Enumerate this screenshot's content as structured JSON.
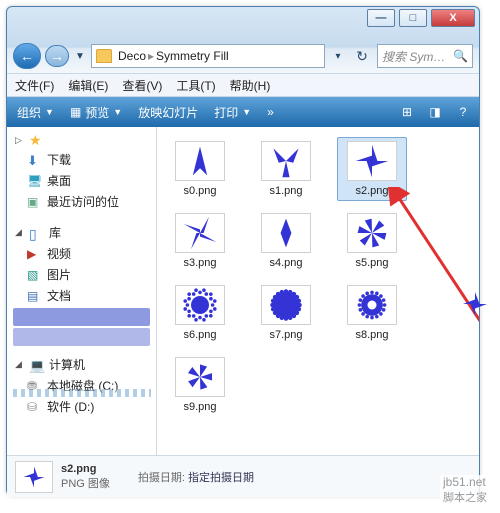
{
  "title_buttons": {
    "min": "—",
    "max": "□",
    "close": "X"
  },
  "nav": {
    "back": "←",
    "fwd": "→",
    "chev": "▼"
  },
  "address": {
    "crumb1": "Deco",
    "sep": "▸",
    "crumb2": "Symmetry Fill",
    "dropdown": "▾",
    "refresh": "↻"
  },
  "search": {
    "placeholder": "搜索 Sym…",
    "icon": "🔍"
  },
  "menu": {
    "file": "文件(F)",
    "edit": "编辑(E)",
    "view": "查看(V)",
    "tools": "工具(T)",
    "help": "帮助(H)"
  },
  "cmd": {
    "organize": "组织",
    "preview": "预览",
    "slideshow": "放映幻灯片",
    "print": "打印",
    "more": "»",
    "dd": "▼"
  },
  "sidebar": {
    "fav": "收藏",
    "downloads": "下载",
    "desktop": "桌面",
    "recent": "最近访问的位",
    "lib": "库",
    "video": "视频",
    "pictures": "图片",
    "documents": "文档",
    "computer": "计算机",
    "driveC": "本地磁盘 (C:)",
    "driveD": "软件 (D:)",
    "expand": "▷",
    "expand2": "◢"
  },
  "files": [
    {
      "name": "s0.png",
      "shape": "s0"
    },
    {
      "name": "s1.png",
      "shape": "s1"
    },
    {
      "name": "s2.png",
      "shape": "s2",
      "selected": true
    },
    {
      "name": "s3.png",
      "shape": "s3"
    },
    {
      "name": "s4.png",
      "shape": "s4"
    },
    {
      "name": "s5.png",
      "shape": "s5"
    },
    {
      "name": "s6.png",
      "shape": "s6"
    },
    {
      "name": "s7.png",
      "shape": "s7"
    },
    {
      "name": "s8.png",
      "shape": "s8"
    },
    {
      "name": "s9.png",
      "shape": "s9"
    }
  ],
  "details": {
    "name": "s2.png",
    "type": "PNG 图像",
    "date_label": "拍摄日期:",
    "date_value": "指定拍摄日期"
  },
  "watermark": {
    "line1": "jb51.net",
    "line2": "脚本之家"
  },
  "colors": {
    "shape": "#3434d6",
    "arrow": "#e03030"
  }
}
